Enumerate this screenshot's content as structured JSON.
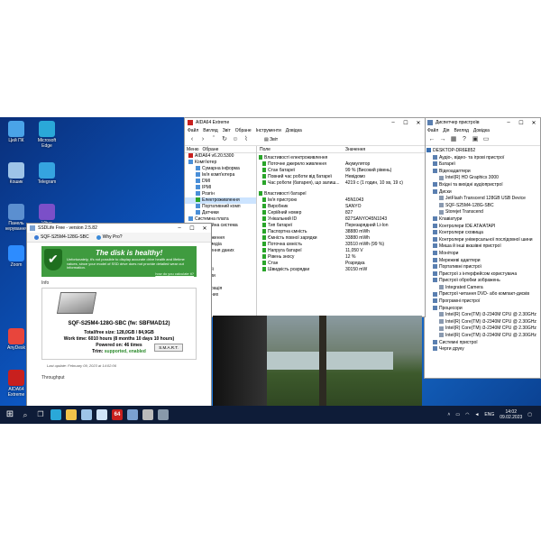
{
  "desktop": {
    "icons": [
      {
        "label": "Цей ПК",
        "icon": "pc-icon",
        "color": "#4aa3e8"
      },
      {
        "label": "Microsoft Edge",
        "icon": "edge-icon",
        "color": "#2aa8d8"
      },
      {
        "label": "Кошик",
        "icon": "recycle-bin-icon",
        "color": "#9ec4e8"
      },
      {
        "label": "Telegram",
        "icon": "telegram-icon",
        "color": "#35a4e0"
      },
      {
        "label": "Панель керування",
        "icon": "control-panel-icon",
        "color": "#5b8fd0"
      },
      {
        "label": "Viber",
        "icon": "viber-icon",
        "color": "#7b4fc8"
      },
      {
        "label": "Zoom",
        "icon": "zoom-icon",
        "color": "#2d8cff"
      },
      {
        "label": "Google Chrome",
        "icon": "chrome-icon",
        "color": "#e8453c"
      },
      {
        "label": "AnyDesk",
        "icon": "anydesk-icon",
        "color": "#e8453c"
      },
      {
        "label": "AIDA64 Extreme",
        "icon": "aida64-icon",
        "color": "#c8201e"
      }
    ]
  },
  "aida": {
    "title": "AIDA64 Extreme",
    "menu": [
      "Файл",
      "Вигляд",
      "Звіт",
      "Обране",
      "Інструменти",
      "Довідка"
    ],
    "toolbar_label": "Звіт",
    "tree_tabs": [
      "Меню",
      "Обране"
    ],
    "tree": [
      "AIDA64 v6.20.5300",
      "Комп'ютер",
      "Сумарна інформа",
      "Ім'я комп'ютера",
      "DMI",
      "IPMI",
      "Розгін",
      "Електроживлення",
      "Портативний комп",
      "Датчики",
      "Системна плата",
      "Операційна система",
      "Сервер",
      "Відображення",
      "Мультимедіа",
      "Збереження даних",
      "Мережа",
      "DirectX",
      "Пристрої",
      "Програми",
      "Безпека",
      "Конфігурація",
      "База даних",
      "Тест"
    ],
    "columns": [
      "Поле",
      "Значення"
    ],
    "rows": [
      {
        "k": "Властивості електроживлення",
        "v": "",
        "grp": true
      },
      {
        "k": "Поточне джерело живлення",
        "v": "Акумулятор"
      },
      {
        "k": "Стан батареї",
        "v": "99 % (Високий рівень)"
      },
      {
        "k": "Повний час роботи від батареї",
        "v": "Невідомо"
      },
      {
        "k": "Час роботи (батарея), що залиш...",
        "v": "4219 с (1 годин, 10 хв, 19 с)"
      },
      {
        "k": "",
        "v": "",
        "gap": true
      },
      {
        "k": "Властивості батареї",
        "v": "",
        "grp": true
      },
      {
        "k": "Ім'я пристрою",
        "v": "45N1043"
      },
      {
        "k": "Виробник",
        "v": "SANYO"
      },
      {
        "k": "Серійний номер",
        "v": "827"
      },
      {
        "k": "Унікальний ID",
        "v": "827SANYO45N1043"
      },
      {
        "k": "Тип батареї",
        "v": "Перезарядний Li-Ion"
      },
      {
        "k": "Паспортна ємність",
        "v": "38880 mWh"
      },
      {
        "k": "Ємність повної зарядки",
        "v": "33880 mWh"
      },
      {
        "k": "Поточна ємність",
        "v": "33510 mWh  (99 %)"
      },
      {
        "k": "Напруга батареї",
        "v": "11,050 V"
      },
      {
        "k": "Рівень зносу",
        "v": "12 %"
      },
      {
        "k": "Стан",
        "v": "Розрядка"
      },
      {
        "k": "Швидкість розрядки",
        "v": "30150 mW"
      }
    ]
  },
  "devmgr": {
    "title": "Диспетчер пристроїв",
    "menu": [
      "Файл",
      "Дія",
      "Вигляд",
      "Довідка"
    ],
    "items": [
      {
        "label": "DESKTOP-DR6E852",
        "indent": 0
      },
      {
        "label": "Аудіо-, відео- та ігрові пристрої",
        "indent": 1
      },
      {
        "label": "Батареї",
        "indent": 1
      },
      {
        "label": "Відеоадаптери",
        "indent": 1
      },
      {
        "label": "Intel(R) HD Graphics 3000",
        "indent": 2
      },
      {
        "label": "Вхідні та вихідні аудіопристрої",
        "indent": 1
      },
      {
        "label": "Диски",
        "indent": 1
      },
      {
        "label": "JetFlash Transcend 128GB USB Device",
        "indent": 2
      },
      {
        "label": "SQF-S25M4-128G-SBC",
        "indent": 2
      },
      {
        "label": "Storejet Transcend",
        "indent": 2
      },
      {
        "label": "Клавіатури",
        "indent": 1
      },
      {
        "label": "Контролери IDE ATA/ATAPI",
        "indent": 1
      },
      {
        "label": "Контролери сховища",
        "indent": 1
      },
      {
        "label": "Контролери універсальної послідовної шини",
        "indent": 1
      },
      {
        "label": "Миша й інші вказівні пристрої",
        "indent": 1
      },
      {
        "label": "Монітори",
        "indent": 1
      },
      {
        "label": "Мережеві адаптери",
        "indent": 1
      },
      {
        "label": "Портативні пристрої",
        "indent": 1
      },
      {
        "label": "Пристрої з інтерфейсом користувача",
        "indent": 1
      },
      {
        "label": "Пристрої обробки зображень",
        "indent": 1
      },
      {
        "label": "Integrated Camera",
        "indent": 2
      },
      {
        "label": "Пристрої читання DVD- або компакт-дисків",
        "indent": 1
      },
      {
        "label": "Програмні пристрої",
        "indent": 1
      },
      {
        "label": "Процесори",
        "indent": 1
      },
      {
        "label": "Intel(R) Core(TM) i3-2340M CPU @ 2.30GHz",
        "indent": 2
      },
      {
        "label": "Intel(R) Core(TM) i3-2340M CPU @ 2.30GHz",
        "indent": 2
      },
      {
        "label": "Intel(R) Core(TM) i3-2340M CPU @ 2.30GHz",
        "indent": 2
      },
      {
        "label": "Intel(R) Core(TM) i3-2340M CPU @ 2.30GHz",
        "indent": 2
      },
      {
        "label": "Системні пристрої",
        "indent": 1
      },
      {
        "label": "Черги друку",
        "indent": 1
      }
    ]
  },
  "ssd": {
    "title": "SSDLife Free - version 2.5.82",
    "tab_drive": "SQF-S25M4-128G-SBC",
    "tab_why": "Why Pro?",
    "healthy_title": "The disk is healthy!",
    "healthy_text": "Unfortunately, it's not possible to display accurate drive health and lifetime values, since your model of SSD drive does not provide detailed wear out information.",
    "healthy_link": "how do you calculate it?",
    "info_label": "Info",
    "model": "SQF-S25M4-128G-SBC (fw: SBFMAD12)",
    "size_label": "Total/free size:",
    "size_value": "128,0GB / 84,9GB",
    "worktime_label": "Work time:",
    "worktime_value": "6010 hours (8 months 10 days 10 hours)",
    "powered_label": "Powered on:",
    "powered_value": "46 times",
    "trim_label": "Trim:",
    "trim_value": "supported, enabled",
    "smart_button": "S.M.A.R.T.",
    "updated": "Last update: February 09, 2023 at 14:02:06",
    "throughput_label": "Throughput"
  },
  "taskbar": {
    "apps": [
      {
        "icon": "start-icon",
        "color": "#ffffff"
      },
      {
        "icon": "search-icon",
        "color": "#dddddd"
      },
      {
        "icon": "task-view-icon",
        "color": "#dddddd"
      },
      {
        "icon": "edge-icon",
        "color": "#2aa8d8"
      },
      {
        "icon": "explorer-icon",
        "color": "#f3c34a"
      },
      {
        "icon": "store-icon",
        "color": "#9ec4e8"
      },
      {
        "icon": "mail-icon",
        "color": "#cfe3f8"
      },
      {
        "icon": "aida64-icon",
        "color": "#c8201e"
      },
      {
        "icon": "ssdlife-icon",
        "color": "#7aa0d0"
      },
      {
        "icon": "device-manager-icon",
        "color": "#bbbbbb"
      },
      {
        "icon": "photos-icon",
        "color": "#8899aa"
      }
    ],
    "aida_label": "64",
    "lang": "ENG",
    "time": "14:02",
    "date": "09.02.2023"
  }
}
